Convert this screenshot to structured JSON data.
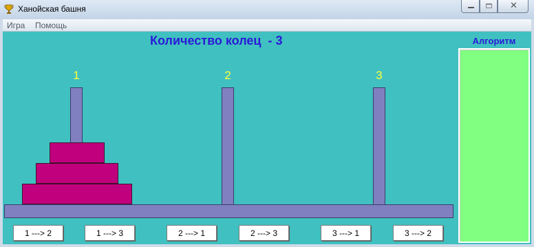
{
  "window": {
    "title": "Ханойская башня",
    "close_glyph": "✕"
  },
  "menu": {
    "items": [
      "Игра",
      "Помощь"
    ]
  },
  "game": {
    "heading": "Количество колец  - 3",
    "rings_count": 3,
    "pegs": [
      {
        "label": "1",
        "rings": [
          3,
          2,
          1
        ]
      },
      {
        "label": "2",
        "rings": []
      },
      {
        "label": "3",
        "rings": []
      }
    ],
    "ring_color": "#c0007c",
    "peg_color": "#8080c0",
    "background_color": "#40c0c0"
  },
  "moves": {
    "buttons": [
      "1 ---> 2",
      "1 ---> 3",
      "2 ---> 1",
      "2 ---> 3",
      "3 ---> 1",
      "3 ---> 2"
    ]
  },
  "algorithm": {
    "title": "Алгоритм",
    "panel_color": "#80ff80",
    "lines": []
  },
  "icons": {
    "app": "trophy-icon",
    "minimize": "minimize-icon",
    "maximize": "maximize-icon",
    "close": "close-icon"
  }
}
